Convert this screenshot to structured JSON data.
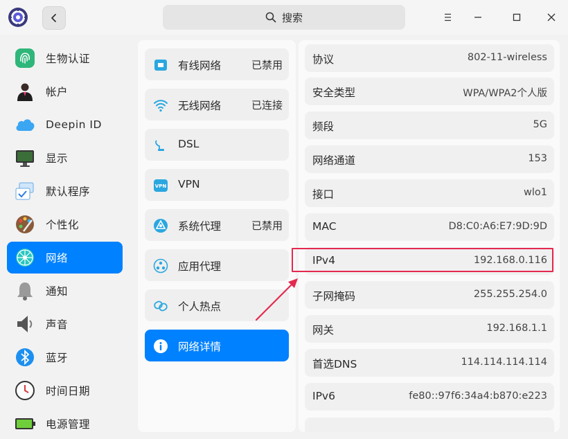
{
  "titlebar": {
    "search_label": "搜索",
    "app_icon": "deepin-control-center-icon",
    "back_icon": "chevron-left-icon",
    "search_icon": "search-icon",
    "menu_icon": "hamburger-menu-icon",
    "minimize_icon": "minimize-icon",
    "maximize_icon": "maximize-icon",
    "close_icon": "close-icon"
  },
  "sidebar": {
    "items": [
      {
        "label": "生物认证",
        "icon": "fingerprint-icon"
      },
      {
        "label": "帐户",
        "icon": "account-user-icon"
      },
      {
        "label": "Deepin ID",
        "icon": "cloud-icon"
      },
      {
        "label": "显示",
        "icon": "monitor-icon"
      },
      {
        "label": "默认程序",
        "icon": "default-apps-icon"
      },
      {
        "label": "个性化",
        "icon": "palette-icon"
      },
      {
        "label": "网络",
        "icon": "network-globe-icon",
        "active": true
      },
      {
        "label": "通知",
        "icon": "bell-icon"
      },
      {
        "label": "声音",
        "icon": "speaker-icon"
      },
      {
        "label": "蓝牙",
        "icon": "bluetooth-icon"
      },
      {
        "label": "时间日期",
        "icon": "clock-icon"
      },
      {
        "label": "电源管理",
        "icon": "battery-icon"
      }
    ]
  },
  "network_menu": {
    "items": [
      {
        "label": "有线网络",
        "status": "已禁用",
        "icon": "wired-network-icon"
      },
      {
        "label": "无线网络",
        "status": "已连接",
        "icon": "wifi-icon"
      },
      {
        "label": "DSL",
        "status": "",
        "icon": "dsl-icon"
      },
      {
        "label": "VPN",
        "status": "",
        "icon": "vpn-icon"
      },
      {
        "label": "系统代理",
        "status": "已禁用",
        "icon": "system-proxy-icon"
      },
      {
        "label": "应用代理",
        "status": "",
        "icon": "app-proxy-icon"
      },
      {
        "label": "个人热点",
        "status": "",
        "icon": "hotspot-icon"
      },
      {
        "label": "网络详情",
        "status": "",
        "icon": "info-icon",
        "active": true
      }
    ]
  },
  "details": {
    "rows": [
      {
        "key": "协议",
        "value": "802-11-wireless"
      },
      {
        "key": "安全类型",
        "value": "WPA/WPA2个人版"
      },
      {
        "key": "频段",
        "value": "5G"
      },
      {
        "key": "网络通道",
        "value": "153"
      },
      {
        "key": "接口",
        "value": "wlo1"
      },
      {
        "key": "MAC",
        "value": "D8:C0:A6:E7:9D:9D"
      },
      {
        "key": "IPv4",
        "value": "192.168.0.116"
      },
      {
        "key": "子网掩码",
        "value": "255.255.254.0"
      },
      {
        "key": "网关",
        "value": "192.168.1.1"
      },
      {
        "key": "首选DNS",
        "value": "114.114.114.114"
      },
      {
        "key": "IPv6",
        "value": "fe80::97f6:34a4:b870:e223"
      }
    ]
  },
  "colors": {
    "accent": "#0081ff",
    "highlight_border": "#e4284e",
    "arrow": "#e4284e"
  }
}
